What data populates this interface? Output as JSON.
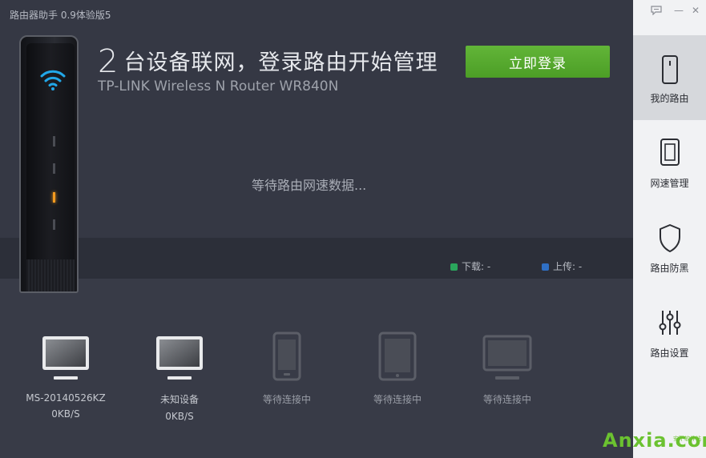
{
  "window": {
    "title": "路由器助手 0.9体验版5",
    "feedback_icon": "chat-bubble-icon",
    "minimize_label": "—",
    "close_label": "✕"
  },
  "header": {
    "device_count": "2",
    "headline": "台设备联网，登录路由开始管理",
    "model": "TP-LINK Wireless N Router WR840N",
    "login_button": "立即登录"
  },
  "status": {
    "waiting_text": "等待路由网速数据..."
  },
  "legend": {
    "download_label": "下载: -",
    "download_color": "#2aa65c",
    "upload_label": "上传: -",
    "upload_color": "#2f6fc4"
  },
  "devices": [
    {
      "icon": "monitor-icon",
      "name": "MS-20140526KZ",
      "speed": "0KB/S"
    },
    {
      "icon": "monitor-icon",
      "name": "未知设备",
      "speed": "0KB/S"
    },
    {
      "icon": "phone-icon",
      "name": "等待连接中",
      "speed": ""
    },
    {
      "icon": "tablet-icon",
      "name": "等待连接中",
      "speed": ""
    },
    {
      "icon": "monitor-icon",
      "name": "等待连接中",
      "speed": ""
    }
  ],
  "sidebar": {
    "items": [
      {
        "label": "我的路由",
        "icon": "router-icon",
        "active": true
      },
      {
        "label": "网速管理",
        "icon": "tablet-frame-icon",
        "active": false
      },
      {
        "label": "路由防黑",
        "icon": "shield-icon",
        "active": false
      },
      {
        "label": "路由设置",
        "icon": "sliders-icon",
        "active": false
      }
    ]
  },
  "watermark": {
    "text": "Anxia.com",
    "sub": "安下软件站"
  }
}
